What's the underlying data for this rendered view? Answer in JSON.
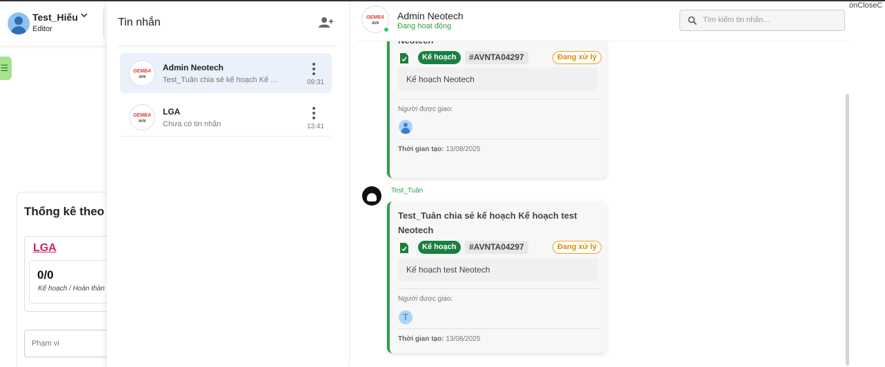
{
  "user": {
    "name": "Test_Hiếu",
    "role": "Editor"
  },
  "sidebar": {
    "menu_icon": "☰"
  },
  "stats": {
    "title": "Thống kê theo d",
    "project": "LGA",
    "count": "0/0",
    "count_label": "Kế hoạch / Hoàn thàn",
    "scope_placeholder": "Phạm vi"
  },
  "messages_panel": {
    "title": "Tin nhắn",
    "conversations": [
      {
        "name": "Admin Neotech",
        "preview": "Test_Tuân chia sẻ kế hoạch Kế hoạch test Neotech",
        "time": "09:31",
        "logo_top": "GEMBA",
        "logo_bottom": "AVN"
      },
      {
        "name": "LGA",
        "preview": "Chưa có tin nhắn",
        "time": "13:41",
        "logo_top": "GEMBA",
        "logo_bottom": "AVN"
      }
    ]
  },
  "chat": {
    "name": "Admin Neotech",
    "status": "Đang hoạt động",
    "search_placeholder": "Tìm kiếm tin nhắn...",
    "logo_top": "GEMBA",
    "logo_bottom": "AVN",
    "corner_text": "onCloseC"
  },
  "messages": [
    {
      "title": "Neotech",
      "type": "Kế hoạch",
      "code": "#AVNTA04297",
      "status": "Đang xử lý",
      "description": "Kế hoạch Neotech",
      "assignee_label": "Người được giao:",
      "created_label": "Thời gian tạo:",
      "created_date": "13/08/2025"
    },
    {
      "sender": "Test_Tuân",
      "title": "Test_Tuân chia sẻ kế hoạch Kế hoạch test Neotech",
      "type": "Kế hoạch",
      "code": "#AVNTA04297",
      "status": "Đang xử lý",
      "description": "Kế hoạch test Neotech",
      "assignee_label": "Người được giao:",
      "assignee_initial": "T",
      "created_label": "Thời gian tạo:",
      "created_date": "13/08/2025"
    }
  ],
  "colors": {
    "accent_green": "#1b7f42",
    "status_orange": "#e08a00",
    "logo_red": "#e53935"
  }
}
